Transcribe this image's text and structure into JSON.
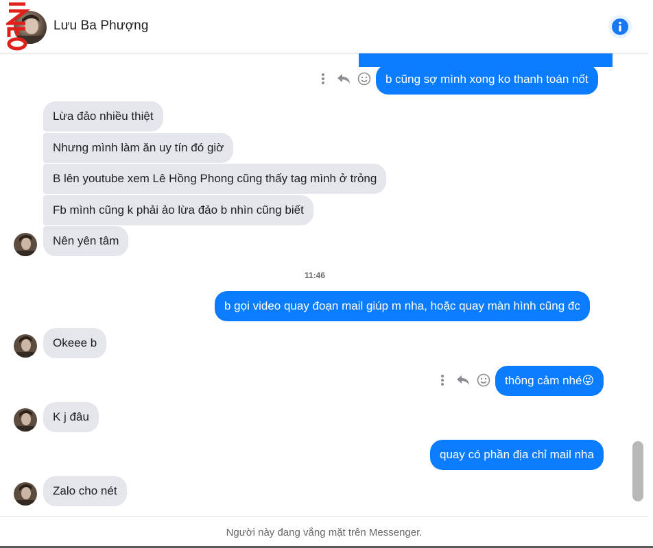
{
  "header": {
    "contact_name": "Lưu Ba Phượng",
    "info_icon": "info-icon",
    "watermark_text": "INFO"
  },
  "messages": {
    "out_partial": "",
    "out_1": "b cũng sợ mình xong ko thanh toán nốt",
    "in_1": "Lừa đảo nhiều thiệt",
    "in_2": "Nhưng mình làm ăn uy tín đó giờ",
    "in_3": "B lên youtube xem Lê Hồng Phong cũng thấy tag mình ở trỏng",
    "in_4": "Fb mình cũng k phải ảo lừa đảo b nhìn cũng biết",
    "in_5": "Nên yên tâm",
    "timestamp": "11:46",
    "out_2": "b gọi video quay đoạn mail giúp m nha, hoặc quay màn hình cũng đc",
    "in_6": "Okeee b",
    "out_3": "thông cảm nhé😜",
    "in_7": "K j đâu",
    "out_4": "quay có phần địa chỉ mail nha",
    "in_8": "Zalo cho nét"
  },
  "footer": {
    "status_text": "Người này đang vắng mặt trên Messenger."
  },
  "icons": {
    "more": "more-vertical-icon",
    "reply": "reply-icon",
    "react": "smiley-icon"
  },
  "colors": {
    "outgoing_bubble": "#0a7cff",
    "incoming_bubble": "#e4e6eb",
    "info_accent": "#1877f2"
  }
}
